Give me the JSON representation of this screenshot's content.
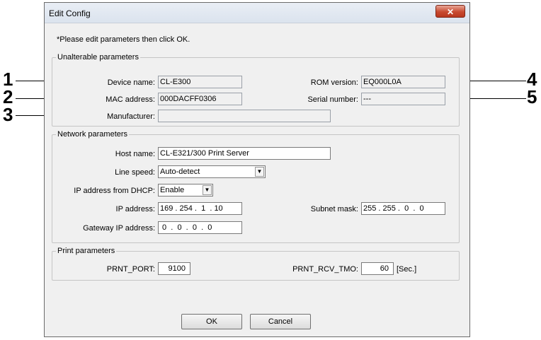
{
  "window": {
    "title": "Edit Config",
    "close_glyph": "✕"
  },
  "instruction": "*Please edit parameters then click OK.",
  "unalterable": {
    "legend": "Unalterable parameters",
    "device_name_label": "Device name:",
    "device_name_value": "CL-E300",
    "mac_label": "MAC address:",
    "mac_value": "000DACFF0306",
    "manufacturer_label": "Manufacturer:",
    "manufacturer_value": "",
    "rom_label": "ROM version:",
    "rom_value": "EQ000L0A",
    "serial_label": "Serial number:",
    "serial_value": "---"
  },
  "network": {
    "legend": "Network parameters",
    "host_label": "Host name:",
    "host_value": "CL-E321/300 Print Server",
    "line_speed_label": "Line speed:",
    "line_speed_value": "Auto-detect",
    "dhcp_label": "IP address from DHCP:",
    "dhcp_value": "Enable",
    "ip_label": "IP address:",
    "ip_value": "169 . 254 .  1  . 10",
    "subnet_label": "Subnet mask:",
    "subnet_value": "255 . 255 .  0  .  0",
    "gateway_label": "Gateway IP address:",
    "gateway_value": " 0  .  0  .  0  .  0"
  },
  "print": {
    "legend": "Print parameters",
    "port_label": "PRNT_PORT:",
    "port_value": "9100",
    "rcv_label": "PRNT_RCV_TMO:",
    "rcv_value": "60",
    "rcv_unit": "[Sec.]"
  },
  "buttons": {
    "ok": "OK",
    "cancel": "Cancel"
  },
  "callouts": [
    "1",
    "2",
    "3",
    "4",
    "5"
  ],
  "colors": {
    "close_button": "#c8492f",
    "dialog_bg": "#f0f0f0"
  }
}
